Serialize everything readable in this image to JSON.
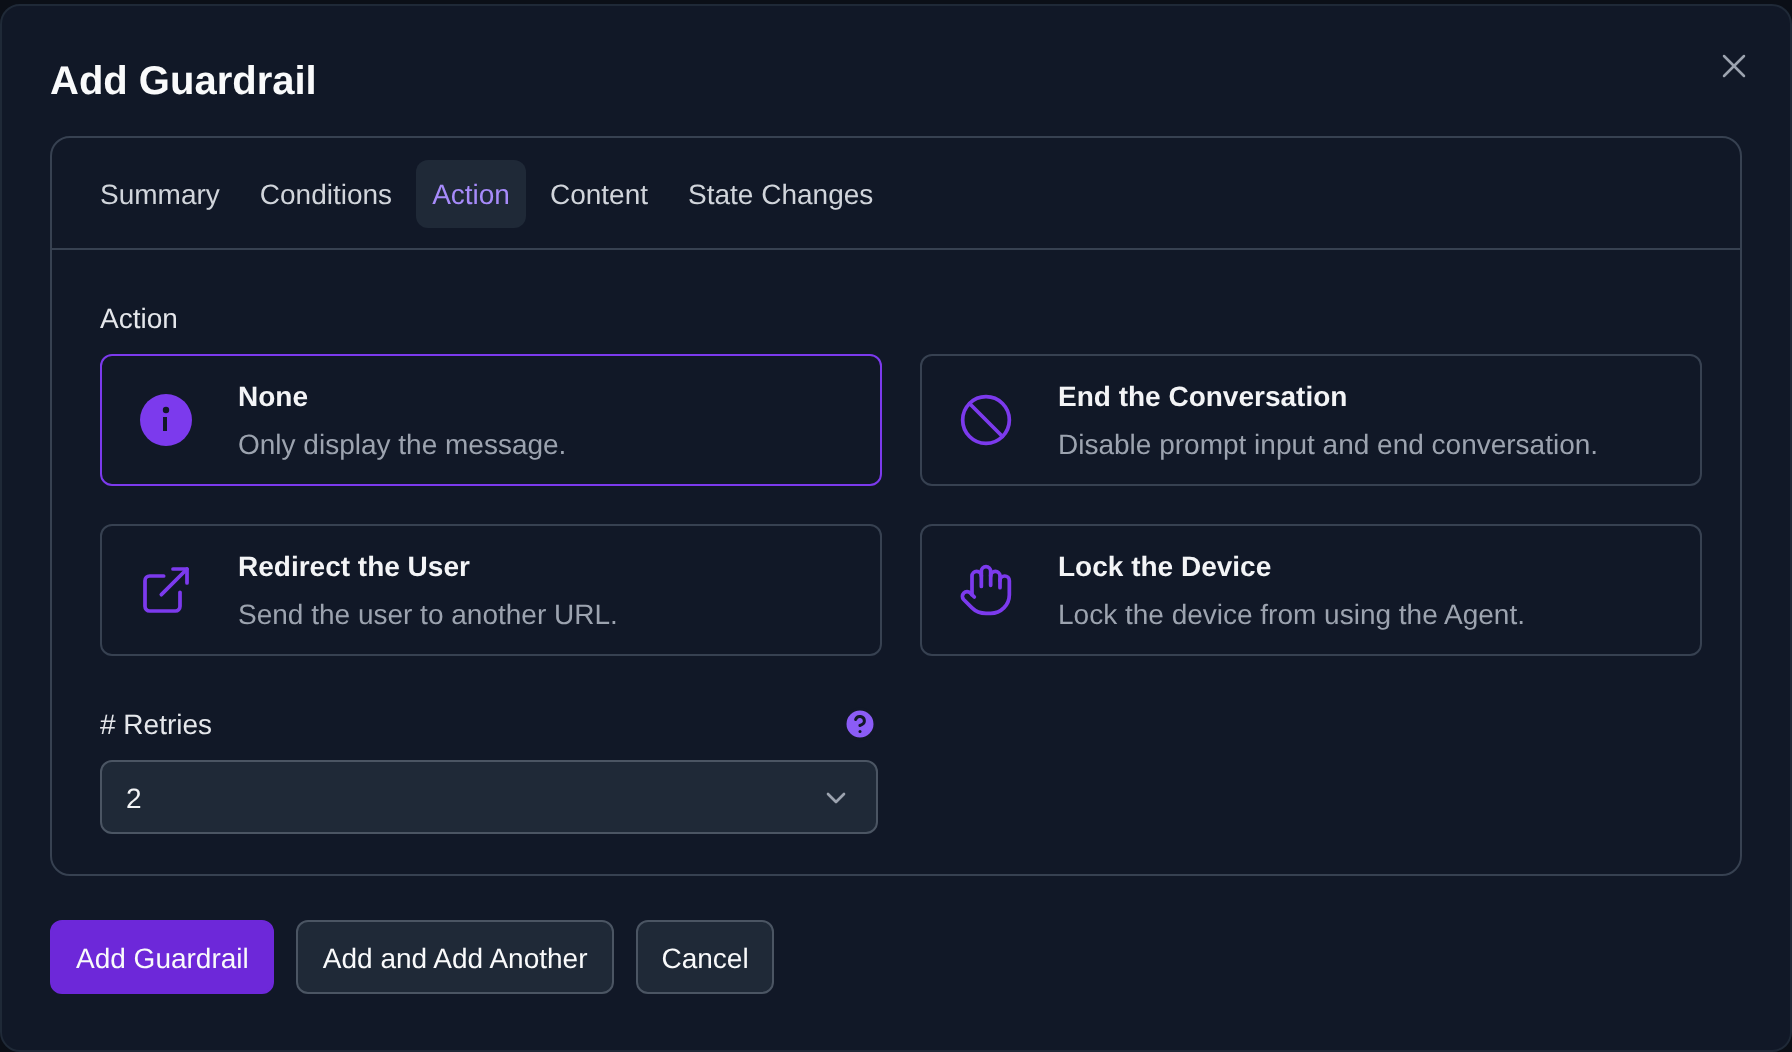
{
  "dialog": {
    "title": "Add Guardrail"
  },
  "tabs": [
    {
      "label": "Summary",
      "selected": false
    },
    {
      "label": "Conditions",
      "selected": false
    },
    {
      "label": "Action",
      "selected": true
    },
    {
      "label": "Content",
      "selected": false
    },
    {
      "label": "State Changes",
      "selected": false
    }
  ],
  "action": {
    "label": "Action",
    "options": [
      {
        "kind": "info",
        "title": "None",
        "description": "Only display the message.",
        "selected": true
      },
      {
        "kind": "ban",
        "title": "End the Conversation",
        "description": "Disable prompt input and end conversation.",
        "selected": false
      },
      {
        "kind": "redirect",
        "title": "Redirect the User",
        "description": "Send the user to another URL.",
        "selected": false
      },
      {
        "kind": "hand",
        "title": "Lock the Device",
        "description": "Lock the device from using the Agent.",
        "selected": false
      }
    ]
  },
  "retries": {
    "label": "# Retries",
    "value": "2"
  },
  "buttons": [
    {
      "label": "Add Guardrail",
      "kind": "primary"
    },
    {
      "label": "Add and Add Another",
      "kind": "secondary"
    },
    {
      "label": "Cancel",
      "kind": "secondary"
    }
  ]
}
